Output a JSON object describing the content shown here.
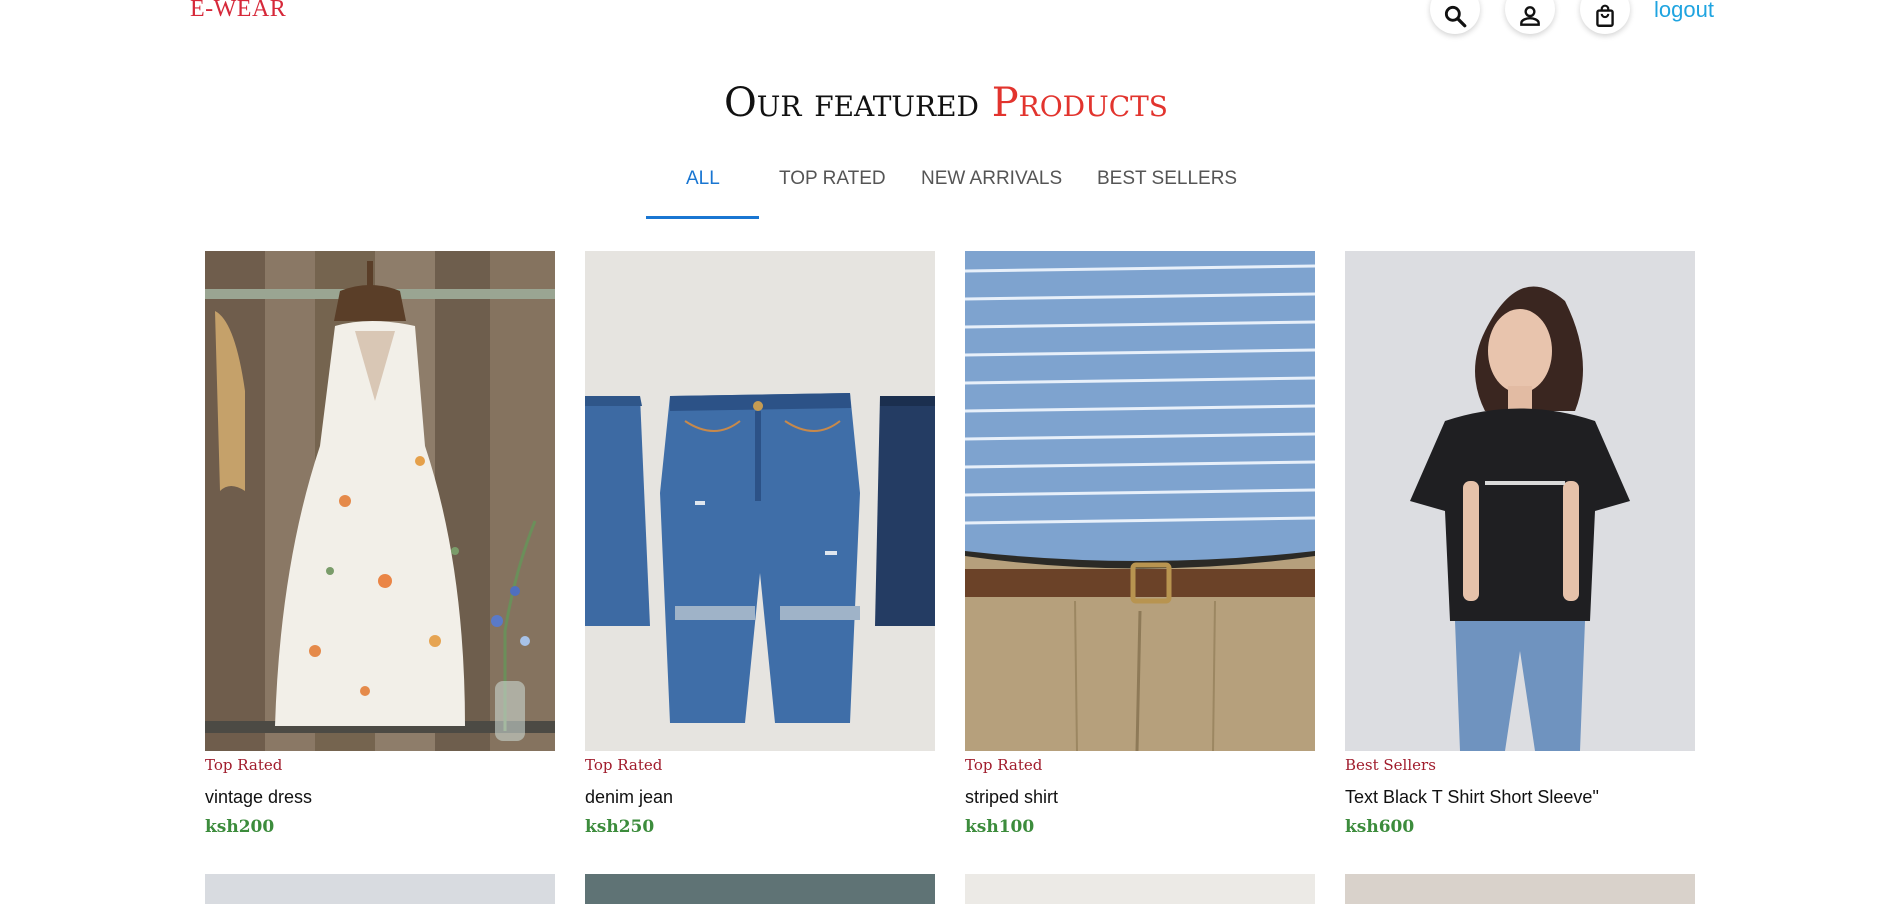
{
  "header": {
    "brand": "E-WEAR",
    "logout_label": "logout",
    "icons": [
      "search-icon",
      "user-icon",
      "shopping-bag-icon"
    ]
  },
  "heading": {
    "main": "Our featured ",
    "accent": "Products"
  },
  "tabs": [
    {
      "label": "ALL",
      "active": true
    },
    {
      "label": "TOP RATED",
      "active": false
    },
    {
      "label": "NEW ARRIVALS",
      "active": false
    },
    {
      "label": "BEST SELLERS",
      "active": false
    }
  ],
  "products": [
    {
      "category": "Top Rated",
      "name": "vintage dress",
      "price": "ksh200"
    },
    {
      "category": "Top Rated",
      "name": "denim jean",
      "price": "ksh250"
    },
    {
      "category": "Top Rated",
      "name": "striped shirt",
      "price": "ksh100"
    },
    {
      "category": "Best Sellers",
      "name": "Text Black T Shirt Short Sleeve\"",
      "price": "ksh600"
    }
  ],
  "colors": {
    "brand": "#d62839",
    "accent": "#e2342e",
    "tab_active": "#1976d2",
    "category": "#a01c2c",
    "price": "#3c8c3c",
    "logout": "#1fa4e0"
  }
}
